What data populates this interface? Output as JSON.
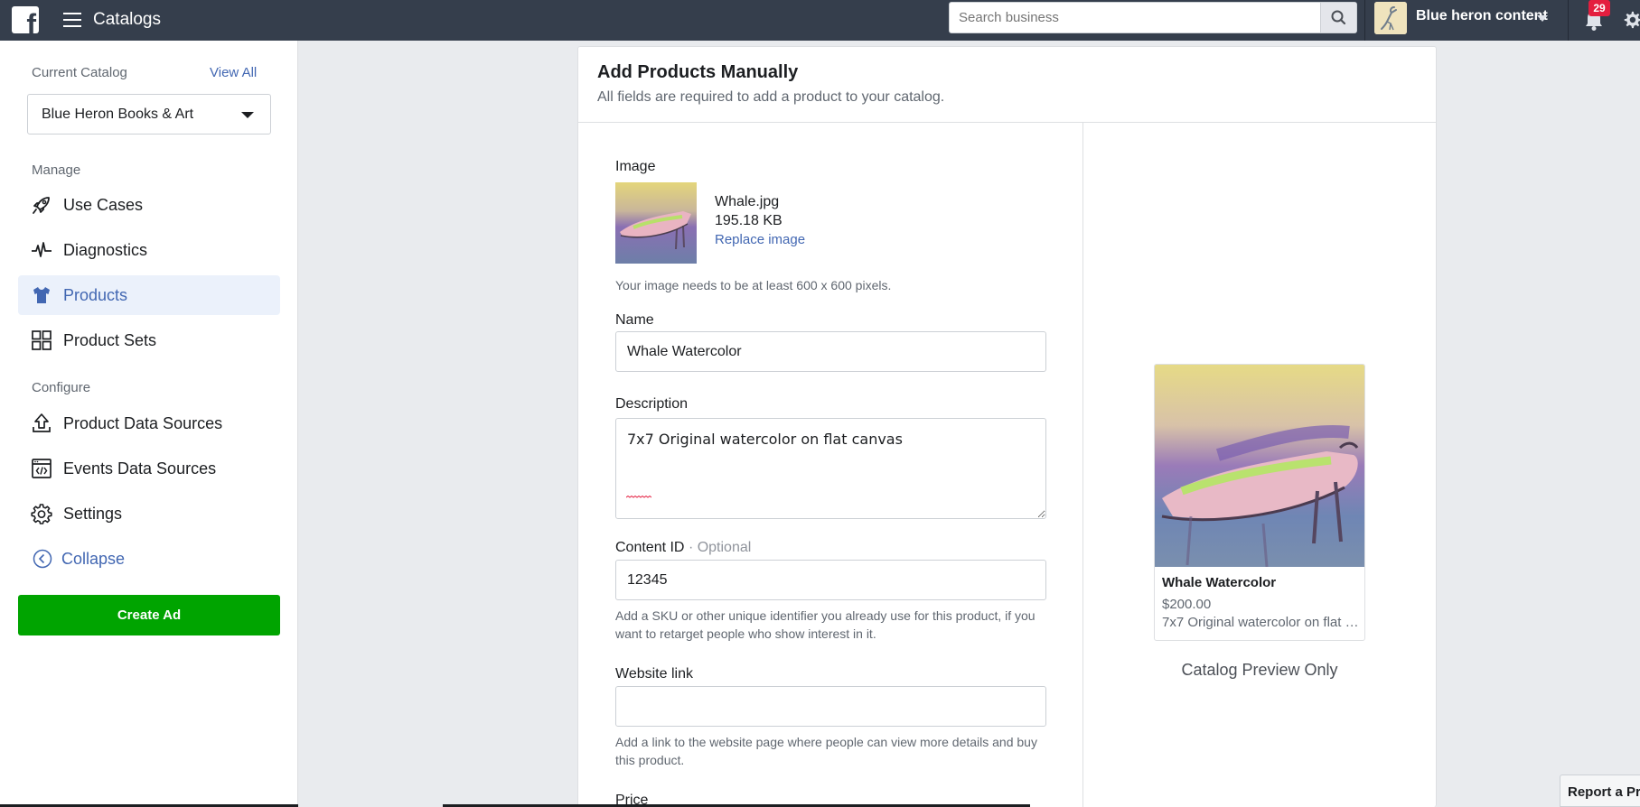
{
  "topbar": {
    "logo": "f",
    "title": "Catalogs",
    "search_placeholder": "Search business",
    "account_name": "Blue heron content",
    "notification_count": "29",
    "icons": [
      "facebook-logo-icon",
      "hamburger-icon",
      "search-icon",
      "bell-icon",
      "gear-icon",
      "chevron-down-icon"
    ]
  },
  "sidebar": {
    "current_catalog_label": "Current Catalog",
    "view_all": "View All",
    "catalog_selected": "Blue Heron Books & Art",
    "manage_label": "Manage",
    "configure_label": "Configure",
    "manage_items": [
      {
        "label": "Use Cases",
        "icon": "rocket-icon"
      },
      {
        "label": "Diagnostics",
        "icon": "pulse-icon"
      },
      {
        "label": "Products",
        "icon": "tshirt-icon",
        "active": true
      },
      {
        "label": "Product Sets",
        "icon": "grid-icon"
      }
    ],
    "configure_items": [
      {
        "label": "Product Data Sources",
        "icon": "upload-icon"
      },
      {
        "label": "Events Data Sources",
        "icon": "code-window-icon"
      },
      {
        "label": "Settings",
        "icon": "gear-icon"
      }
    ],
    "collapse": "Collapse",
    "create_ad": "Create Ad"
  },
  "form": {
    "title": "Add Products Manually",
    "subtitle": "All fields are required to add a product to your catalog.",
    "image": {
      "label": "Image",
      "file_name": "Whale.jpg",
      "file_size": "195.18 KB",
      "replace": "Replace image",
      "help": "Your image needs to be at least 600 x 600 pixels."
    },
    "name": {
      "label": "Name",
      "value": "Whale Watercolor"
    },
    "description": {
      "label": "Description",
      "value": "7x7 Original watercolor on flat canvas"
    },
    "content_id": {
      "label": "Content ID",
      "optional": "· Optional",
      "value": "12345",
      "help": "Add a SKU or other unique identifier you already use for this product, if you want to retarget people who show interest in it."
    },
    "website_link": {
      "label": "Website link",
      "value": "",
      "help": "Add a link to the website page where people can view more details and buy this product."
    },
    "price": {
      "label": "Price"
    }
  },
  "preview": {
    "name": "Whale Watercolor",
    "price": "$200.00",
    "description": "7x7 Original watercolor on flat canvas",
    "caption": "Catalog Preview Only"
  },
  "report_tab": "Report a Pr",
  "colors": {
    "topbar": "#353e4c",
    "link": "#4267b2",
    "create_ad": "#00a400",
    "active_nav_bg": "#ebf1fb",
    "badge": "#e41e3f"
  }
}
